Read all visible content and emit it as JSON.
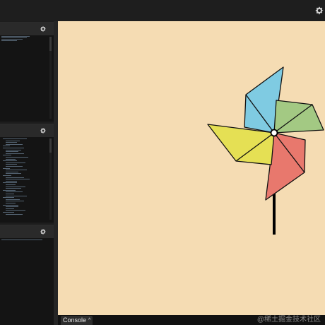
{
  "topbar": {
    "settings_icon": "gear-icon"
  },
  "panels": [
    {
      "id": "html",
      "settings_icon": "gear-icon"
    },
    {
      "id": "css",
      "settings_icon": "gear-icon"
    },
    {
      "id": "js",
      "settings_icon": "gear-icon"
    }
  ],
  "preview": {
    "background": "#f5dcb3",
    "pinwheel": {
      "blades": [
        {
          "name": "blue",
          "color": "#7fcbe2"
        },
        {
          "name": "green",
          "color": "#a3c983"
        },
        {
          "name": "red",
          "color": "#e8786d"
        },
        {
          "name": "yellow",
          "color": "#e5e054"
        }
      ],
      "center_color": "#ffffff",
      "stick_color": "#000000"
    }
  },
  "console": {
    "label": "Console",
    "caret": "^"
  },
  "watermark": {
    "text": "@稀土掘金技术社区"
  }
}
